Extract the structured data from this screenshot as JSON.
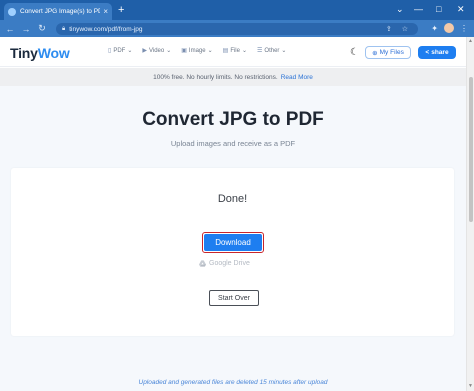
{
  "browser": {
    "tab_title": "Convert JPG Image(s) to PDF Onl",
    "tab_close": "×",
    "new_tab": "+",
    "url": "tinywow.com/pdf/from-jpg",
    "window_controls": {
      "collapse": "⌄",
      "minimize": "—",
      "maximize": "□",
      "close": "✕"
    },
    "nav": {
      "back": "←",
      "forward": "→",
      "reload": "↻"
    },
    "omnibox_tools": "⇪ ☆",
    "toolbar_icons": {
      "extensions": "✦",
      "menu": "⋮"
    }
  },
  "site": {
    "logo_tiny": "Tiny",
    "logo_wow": "Wow",
    "nav": [
      {
        "icon": "▯",
        "label": "PDF"
      },
      {
        "icon": "▶",
        "label": "Video"
      },
      {
        "icon": "▣",
        "label": "Image"
      },
      {
        "icon": "▤",
        "label": "File"
      },
      {
        "icon": "☰",
        "label": "Other"
      }
    ],
    "nav_caret": "⌄",
    "theme_icon": "☾",
    "my_files": "My Files",
    "my_files_icon": "⊕",
    "share": "share",
    "share_icon": "<"
  },
  "notice": {
    "text": "100% free. No hourly limits. No restrictions.",
    "link": "Read More"
  },
  "main": {
    "title": "Convert JPG to PDF",
    "subtitle": "Upload images and receive as a PDF",
    "status": "Done!",
    "download_label": "Download",
    "google_drive_label": "Google Drive",
    "start_over_label": "Start Over",
    "footer_note": "Uploaded and generated files are deleted 15 minutes after upload"
  },
  "colors": {
    "chrome_tabstrip": "#1f5fa8",
    "chrome_toolbar": "#3b7cc4",
    "accent_blue": "#1e7ef0",
    "highlight_red": "#c8262c"
  }
}
